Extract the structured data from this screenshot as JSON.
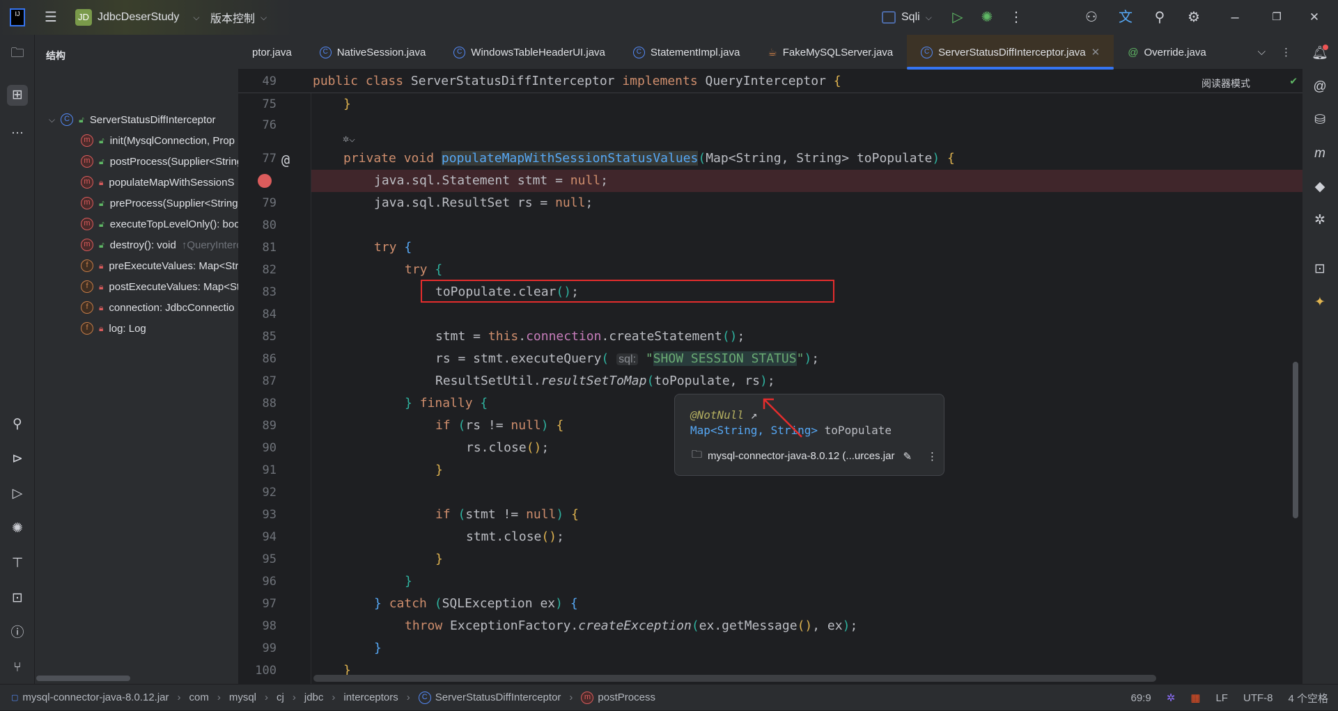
{
  "titlebar": {
    "logo": "IJ",
    "project_badge": "JD",
    "project": "JdbcDeserStudy",
    "vcs": "版本控制",
    "run_config": "Sqli"
  },
  "structure": {
    "title": "结构",
    "root": "ServerStatusDiffInterceptor",
    "items": [
      {
        "kind": "m",
        "access": "public",
        "label": "init(MysqlConnection, Prop"
      },
      {
        "kind": "m",
        "access": "public",
        "label": "postProcess(Supplier<String"
      },
      {
        "kind": "m",
        "access": "private",
        "label": "populateMapWithSessionS"
      },
      {
        "kind": "m",
        "access": "public",
        "label": "preProcess(Supplier<String"
      },
      {
        "kind": "m",
        "access": "public",
        "label": "executeTopLevelOnly(): boo"
      },
      {
        "kind": "m",
        "access": "public",
        "label": "destroy(): void",
        "hint": "↑QueryInterc"
      },
      {
        "kind": "f",
        "access": "private",
        "label": "preExecuteValues: Map<Str"
      },
      {
        "kind": "f",
        "access": "private",
        "label": "postExecuteValues: Map<St"
      },
      {
        "kind": "f",
        "access": "private",
        "label": "connection: JdbcConnectio"
      },
      {
        "kind": "f",
        "access": "private",
        "label": "log: Log"
      }
    ]
  },
  "tabs": [
    {
      "label": "ptor.java",
      "icon": "none"
    },
    {
      "label": "NativeSession.java",
      "icon": "class"
    },
    {
      "label": "WindowsTableHeaderUI.java",
      "icon": "class"
    },
    {
      "label": "StatementImpl.java",
      "icon": "class"
    },
    {
      "label": "FakeMySQLServer.java",
      "icon": "java"
    },
    {
      "label": "ServerStatusDiffInterceptor.java",
      "icon": "class",
      "active": true
    },
    {
      "label": "Override.java",
      "icon": "annotation"
    }
  ],
  "editor": {
    "reader_mode": "阅读器模式",
    "sticky": {
      "num": "49",
      "tokens": [
        [
          "public class ",
          "kw"
        ],
        [
          "ServerStatusDiffInterceptor ",
          ""
        ],
        [
          "implements ",
          "kw"
        ],
        [
          "QueryInterceptor ",
          ""
        ],
        [
          "{",
          "b1"
        ]
      ]
    },
    "lines": [
      {
        "num": "75",
        "indent": 1,
        "tokens": [
          [
            "}",
            "b1"
          ]
        ]
      },
      {
        "num": "76",
        "indent": 0,
        "tokens": []
      },
      {
        "num": "77",
        "indent": 1,
        "tokens": [
          [
            "private void ",
            "kw"
          ],
          [
            "populateMapWithSessionStatusValues",
            "fn hl"
          ],
          [
            "(",
            "b3"
          ],
          [
            "Map<String, String> toPopulate",
            ""
          ],
          [
            ")",
            "b3"
          ],
          [
            " {",
            "b1"
          ]
        ]
      },
      {
        "num": "",
        "indent": 2,
        "bp": true,
        "tokens": [
          [
            "java.sql.Statement stmt = ",
            ""
          ],
          [
            "null",
            "kw"
          ],
          [
            ";",
            ""
          ]
        ]
      },
      {
        "num": "79",
        "indent": 2,
        "tokens": [
          [
            "java.sql.ResultSet rs = ",
            ""
          ],
          [
            "null",
            "kw"
          ],
          [
            ";",
            ""
          ]
        ]
      },
      {
        "num": "80",
        "indent": 0,
        "tokens": []
      },
      {
        "num": "81",
        "indent": 2,
        "tokens": [
          [
            "try ",
            "kw"
          ],
          [
            "{",
            "b2"
          ]
        ]
      },
      {
        "num": "82",
        "indent": 3,
        "tokens": [
          [
            "try ",
            "kw"
          ],
          [
            "{",
            "b3"
          ]
        ]
      },
      {
        "num": "83",
        "indent": 4,
        "tokens": [
          [
            "toPopulate.clear",
            ""
          ],
          [
            "()",
            "b3"
          ],
          [
            ";",
            ""
          ]
        ]
      },
      {
        "num": "84",
        "indent": 0,
        "tokens": []
      },
      {
        "num": "85",
        "indent": 4,
        "tokens": [
          [
            "stmt = ",
            ""
          ],
          [
            "this",
            "kw"
          ],
          [
            ".",
            ""
          ],
          [
            "connection",
            "fld"
          ],
          [
            ".createStatement",
            ""
          ],
          [
            "()",
            "b3"
          ],
          [
            ";",
            ""
          ]
        ]
      },
      {
        "num": "86",
        "indent": 4,
        "tokens": [
          [
            "rs = stmt.executeQuery",
            ""
          ],
          [
            "(",
            "b3"
          ],
          [
            " ",
            ""
          ],
          [
            "sql:",
            "inlay"
          ],
          [
            " ",
            ""
          ],
          [
            "\"",
            "str"
          ],
          [
            "SHOW SESSION STATUS",
            "str strbg"
          ],
          [
            "\"",
            "str"
          ],
          [
            ")",
            "b3"
          ],
          [
            ";",
            ""
          ]
        ]
      },
      {
        "num": "87",
        "indent": 4,
        "tokens": [
          [
            "ResultSetUtil.",
            ""
          ],
          [
            "resultSetToMap",
            "it"
          ],
          [
            "(",
            "b3"
          ],
          [
            "toPopulate, rs",
            ""
          ],
          [
            ")",
            "b3"
          ],
          [
            ";",
            ""
          ]
        ]
      },
      {
        "num": "88",
        "indent": 3,
        "tokens": [
          [
            "} ",
            "b3"
          ],
          [
            "finally ",
            "kw"
          ],
          [
            "{",
            "b3"
          ]
        ]
      },
      {
        "num": "89",
        "indent": 4,
        "tokens": [
          [
            "if ",
            "kw"
          ],
          [
            "(",
            "b3"
          ],
          [
            "rs != ",
            ""
          ],
          [
            "null",
            "kw"
          ],
          [
            ") ",
            "b3"
          ],
          [
            "{",
            "b1"
          ]
        ]
      },
      {
        "num": "90",
        "indent": 5,
        "tokens": [
          [
            "rs.close",
            ""
          ],
          [
            "()",
            "b1"
          ],
          [
            ";",
            ""
          ]
        ]
      },
      {
        "num": "91",
        "indent": 4,
        "tokens": [
          [
            "}",
            "b1"
          ]
        ]
      },
      {
        "num": "92",
        "indent": 0,
        "tokens": []
      },
      {
        "num": "93",
        "indent": 4,
        "tokens": [
          [
            "if ",
            "kw"
          ],
          [
            "(",
            "b3"
          ],
          [
            "stmt != ",
            ""
          ],
          [
            "null",
            "kw"
          ],
          [
            ") ",
            "b3"
          ],
          [
            "{",
            "b1"
          ]
        ]
      },
      {
        "num": "94",
        "indent": 5,
        "tokens": [
          [
            "stmt.close",
            ""
          ],
          [
            "()",
            "b1"
          ],
          [
            ";",
            ""
          ]
        ]
      },
      {
        "num": "95",
        "indent": 4,
        "tokens": [
          [
            "}",
            "b1"
          ]
        ]
      },
      {
        "num": "96",
        "indent": 3,
        "tokens": [
          [
            "}",
            "b3"
          ]
        ]
      },
      {
        "num": "97",
        "indent": 2,
        "tokens": [
          [
            "} ",
            "b2"
          ],
          [
            "catch ",
            "kw"
          ],
          [
            "(",
            "b3"
          ],
          [
            "SQLException ex",
            ""
          ],
          [
            ") ",
            "b3"
          ],
          [
            "{",
            "b2"
          ]
        ]
      },
      {
        "num": "98",
        "indent": 3,
        "tokens": [
          [
            "throw ",
            "kw"
          ],
          [
            "ExceptionFactory.",
            ""
          ],
          [
            "createException",
            "it"
          ],
          [
            "(",
            "b3"
          ],
          [
            "ex.getMessage",
            ""
          ],
          [
            "()",
            "b1"
          ],
          [
            ", ex",
            ""
          ],
          [
            ")",
            "b3"
          ],
          [
            ";",
            ""
          ]
        ]
      },
      {
        "num": "99",
        "indent": 2,
        "tokens": [
          [
            "}",
            "b2"
          ]
        ]
      },
      {
        "num": "100",
        "indent": 1,
        "tokens": [
          [
            "}",
            "b1"
          ]
        ]
      }
    ]
  },
  "popup": {
    "annotation": "@NotNull",
    "sig_type": "Map<String, String>",
    "sig_name": " toPopulate",
    "source": "mysql-connector-java-8.0.12 (...urces.jar"
  },
  "statusbar": {
    "crumbs": [
      "mysql-connector-java-8.0.12.jar",
      "com",
      "mysql",
      "cj",
      "jdbc",
      "interceptors",
      "ServerStatusDiffInterceptor",
      "postProcess"
    ],
    "position": "69:9",
    "line_sep": "LF",
    "encoding": "UTF-8",
    "indent": "4 个空格"
  },
  "colors": {
    "accent": "#3574f0",
    "breakpoint": "#db5c5c",
    "keyword": "#cf8e6d",
    "string": "#6aab73",
    "function": "#56a8f5"
  }
}
